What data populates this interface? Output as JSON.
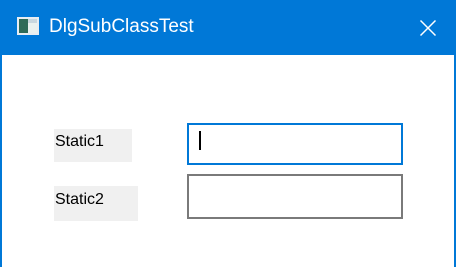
{
  "window": {
    "title": "DlgSubClassTest",
    "icon": "dialog-app-icon",
    "close_icon": "close-icon"
  },
  "dialog": {
    "static1_label": "Static1",
    "static2_label": "Static2",
    "edit1_value": "",
    "edit2_value": ""
  },
  "colors": {
    "titlebar": "#0078d7",
    "focused_border": "#0078d7",
    "edit_border": "#7a7a7a",
    "static_background": "#f0f0f0"
  }
}
